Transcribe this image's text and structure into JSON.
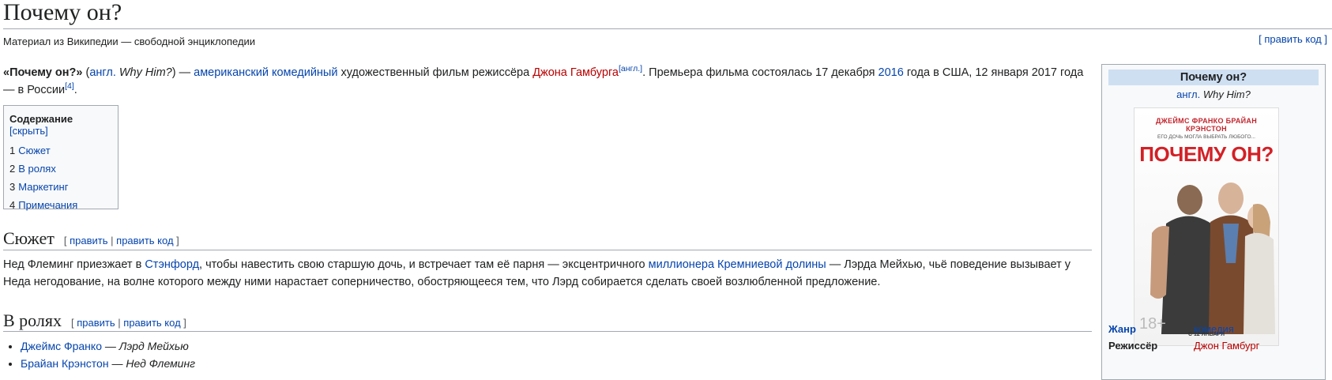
{
  "title": "Почему он?",
  "tagline": "Материал из Википедии — свободной энциклопедии",
  "top_edit": "[ править код ]",
  "lead": {
    "bold_title": "«Почему он?»",
    "p1": " (",
    "lang_link": "англ.",
    "orig_title": "Why Him?",
    "p2": ") — ",
    "link_american": "американский",
    "p3": " ",
    "link_comedy": "комедийный",
    "p4": " художественный фильм режиссёра ",
    "link_director": "Джона Гамбурга",
    "ref_eng": "[англ.]",
    "p5": ". Премьера фильма состоялась 17 декабря ",
    "link_year": "2016",
    "p6": " года в США, 12 января 2017 года — в России",
    "ref4": "[4]",
    "p7": "."
  },
  "toc": {
    "heading": "Содержание",
    "toggle": "[скрыть]",
    "items": [
      {
        "num": "1",
        "label": "Сюжет"
      },
      {
        "num": "2",
        "label": "В ролях"
      },
      {
        "num": "3",
        "label": "Маркетинг"
      },
      {
        "num": "4",
        "label": "Примечания"
      }
    ]
  },
  "section_edit": {
    "open": "[",
    "edit": "править",
    "sep": "|",
    "edit_code": "править код",
    "close": "]"
  },
  "plot": {
    "heading": "Сюжет",
    "t1": "Нед Флеминг приезжает в ",
    "link_stanford": "Стэнфорд",
    "t2": ", чтобы навестить свою старшую дочь, и встречает там её парня — эксцентричного ",
    "link_millionaire": "миллионера",
    "t3": " ",
    "link_valley": "Кремниевой долины",
    "t4": " — Лэрда Мейхью, чьё поведение вызывает у Неда негодование, на волне которого между ними нарастает соперничество, обостряющееся тем, что Лэрд собирается сделать своей возлюбленной предложение."
  },
  "cast": {
    "heading": "В ролях",
    "items": [
      {
        "actor": "Джеймс Франко",
        "dash": " — ",
        "role": "Лэрд Мейхью"
      },
      {
        "actor": "Брайан Крэнстон",
        "dash": " — ",
        "role": "Нед Флеминг"
      }
    ]
  },
  "infobox": {
    "title": "Почему он?",
    "lang_link": "англ.",
    "orig_title": "Why Him?",
    "poster": {
      "actors": "ДЖЕЙМС ФРАНКО   БРАЙАН КРЭНСТОН",
      "tagline": "ЕГО ДОЧЬ МОГЛА ВЫБРАТЬ ЛЮБОГО...",
      "title": "ПОЧЕМУ ОН?",
      "date": "С 12 ЯНВАРЯ",
      "rating": "18+"
    },
    "rows": [
      {
        "label": "Жанр",
        "value": "комедия"
      },
      {
        "label": "Режиссёр",
        "value": "Джон Гамбург"
      }
    ]
  },
  "colors": {
    "link": "#0645ad",
    "redlink": "#ba0000",
    "infobox_header": "#cedff2",
    "border": "#a2a9b1"
  }
}
